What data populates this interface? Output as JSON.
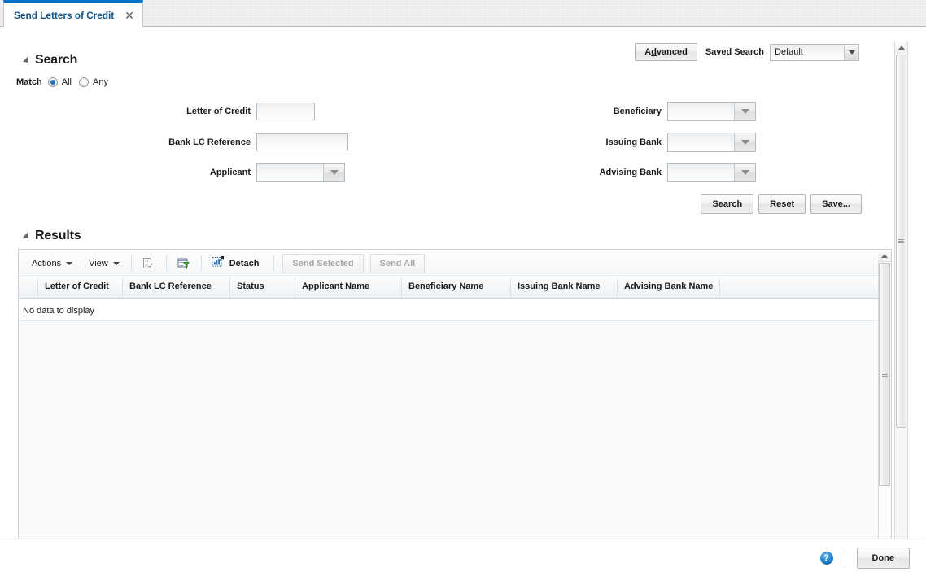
{
  "tab": {
    "label": "Send Letters of Credit",
    "close_icon": "close-icon"
  },
  "search": {
    "title": "Search",
    "disclosure_icon": "triangle-collapse-icon",
    "match": {
      "label": "Match",
      "options": [
        {
          "label": "All",
          "selected": true
        },
        {
          "label": "Any",
          "selected": false
        }
      ]
    },
    "advanced_button": {
      "prefix": "A",
      "accel": "d",
      "suffix": "vanced",
      "full": "Advanced"
    },
    "saved_search_label": "Saved Search",
    "saved_search_value": "Default",
    "fields": {
      "letter_of_credit": {
        "label": "Letter of Credit",
        "value": "",
        "type": "text"
      },
      "bank_lc_reference": {
        "label": "Bank LC Reference",
        "value": "",
        "type": "text"
      },
      "applicant": {
        "label": "Applicant",
        "value": "",
        "type": "lov"
      },
      "beneficiary": {
        "label": "Beneficiary",
        "value": "",
        "type": "lov"
      },
      "issuing_bank": {
        "label": "Issuing Bank",
        "value": "",
        "type": "lov"
      },
      "advising_bank": {
        "label": "Advising Bank",
        "value": "",
        "type": "lov"
      }
    },
    "buttons": {
      "search": "Search",
      "reset": "Reset",
      "save": "Save..."
    }
  },
  "results": {
    "title": "Results",
    "disclosure_icon": "triangle-collapse-icon",
    "toolbar": {
      "actions_menu": "Actions",
      "view_menu": "View",
      "export_icon": "export-to-excel-icon",
      "query_icon": "query-by-example-filter-icon",
      "detach_icon": "detach-icon",
      "detach_label": "Detach",
      "send_selected": "Send Selected",
      "send_all": "Send All"
    },
    "columns": [
      "Letter of Credit",
      "Bank LC Reference",
      "Status",
      "Applicant Name",
      "Beneficiary Name",
      "Issuing Bank Name",
      "Advising Bank Name"
    ],
    "rows": [],
    "empty_message": "No data to display"
  },
  "footer": {
    "help_icon": "help-question-icon",
    "help_glyph": "?",
    "done_button": "Done"
  },
  "colors": {
    "tab_accent": "#0572ce",
    "tab_text": "#14568c",
    "help_blue": "#1a7cc4",
    "panel_border": "#c9d2da"
  }
}
